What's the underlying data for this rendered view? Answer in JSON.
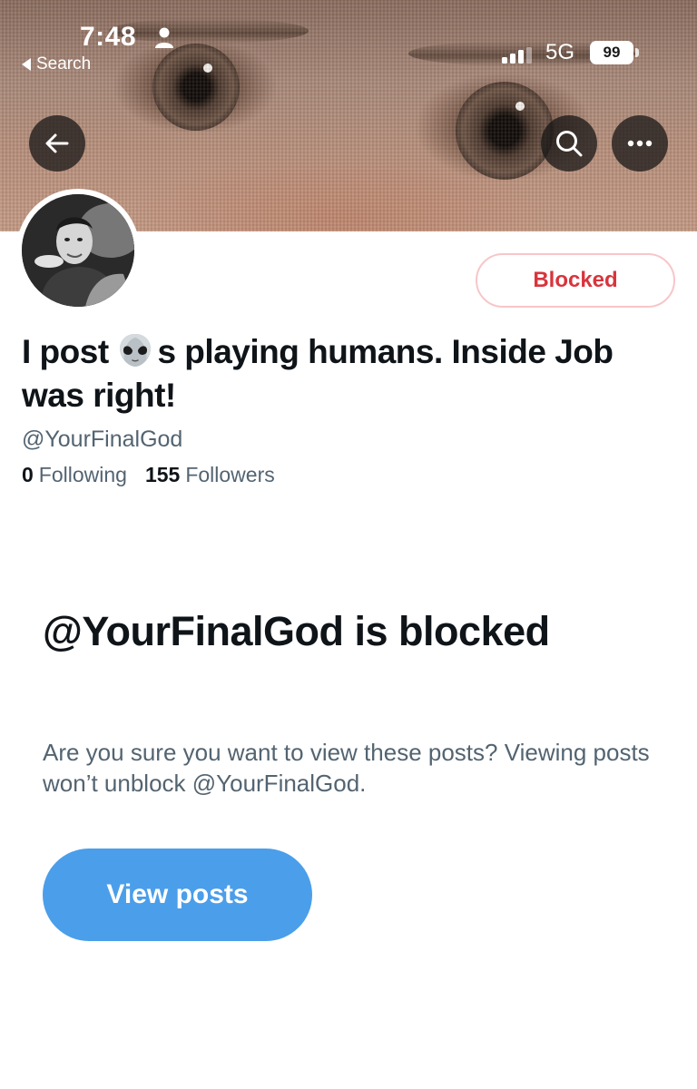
{
  "status_bar": {
    "time": "7:48",
    "back_app_label": "Search",
    "network": "5G",
    "battery": "99"
  },
  "header": {
    "back_icon": "arrow-left-icon",
    "search_icon": "search-icon",
    "more_icon": "more-horizontal-icon"
  },
  "profile": {
    "name_before_emoji": "I post ",
    "name_emoji": "alien-emoji",
    "name_after_emoji": "s playing humans. Inside Job was right!",
    "handle": "@YourFinalGod",
    "following_count": "0",
    "following_label": "Following",
    "followers_count": "155",
    "followers_label": "Followers",
    "blocked_button_label": "Blocked"
  },
  "blocked_notice": {
    "title": "@YourFinalGod is blocked",
    "description": "Are you sure you want to view these posts? Viewing posts won’t unblock @YourFinalGod.",
    "view_posts_label": "View posts"
  },
  "colors": {
    "blocked_red": "#d9343c",
    "primary_blue": "#4b9eea",
    "secondary_text": "#536471"
  }
}
